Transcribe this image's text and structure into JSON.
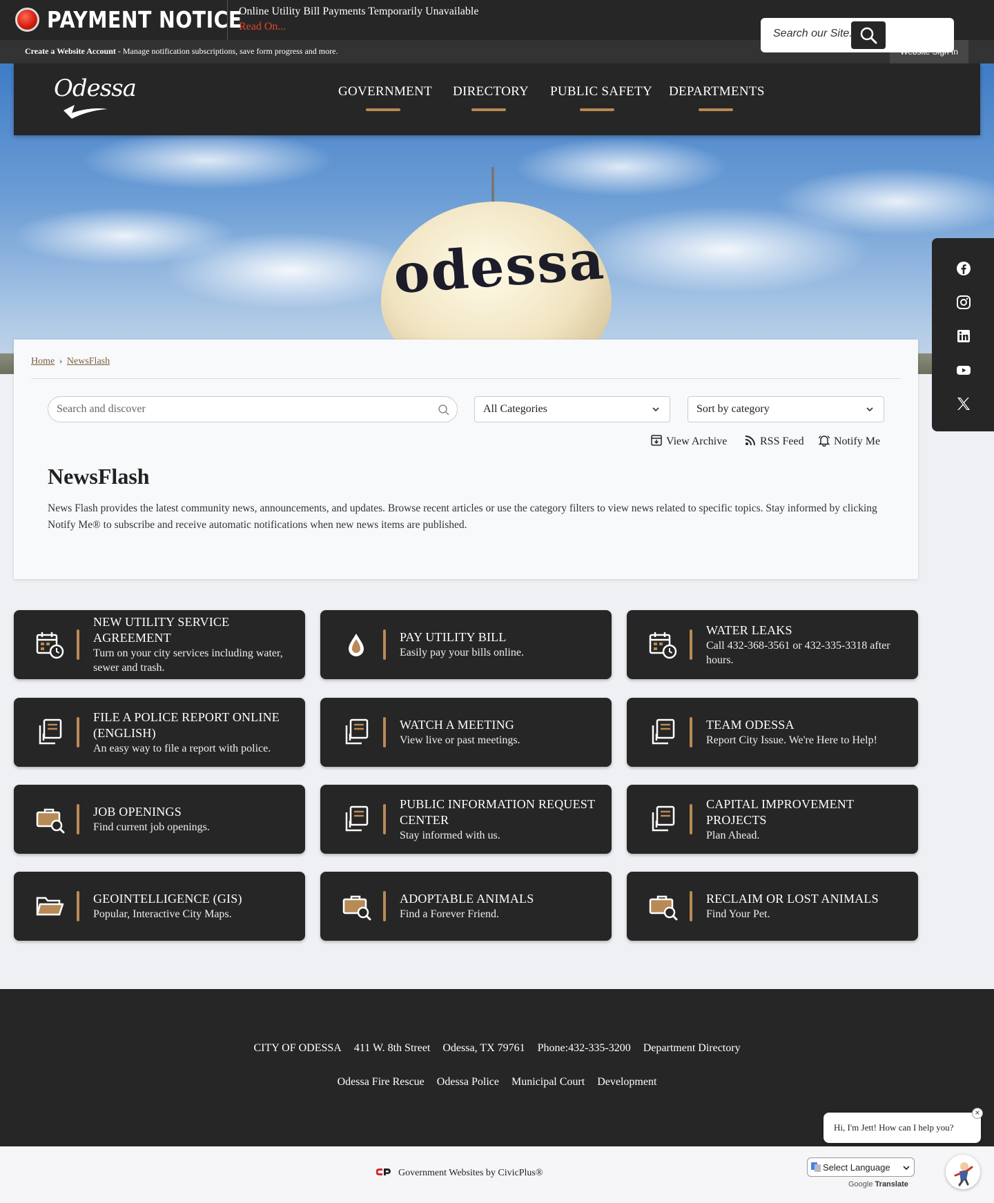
{
  "alert": {
    "title": "PAYMENT NOTICE",
    "message": "Online Utility Bill Payments Temporarily Unavailable",
    "link": "Read On..."
  },
  "account_bar": {
    "create_label": "Create a Website Account",
    "create_desc": " - Manage notification subscriptions, save form progress and more.",
    "signin": "Website Sign In"
  },
  "header": {
    "logo_text": "Odessa",
    "nav": [
      "GOVERNMENT",
      "DIRECTORY",
      "PUBLIC SAFETY",
      "DEPARTMENTS"
    ],
    "search_placeholder": "Search our Site..."
  },
  "hero": {
    "tower_text": "odessa"
  },
  "social": [
    "facebook-icon",
    "instagram-icon",
    "linkedin-icon",
    "youtube-icon",
    "x-icon"
  ],
  "breadcrumb": {
    "home": "Home",
    "sep": "›",
    "current": "NewsFlash"
  },
  "filters": {
    "search_placeholder": "Search and discover",
    "category": "All Categories",
    "sort": "Sort by category"
  },
  "tools": {
    "archive": "View Archive",
    "rss": "RSS Feed",
    "notify": "Notify Me"
  },
  "page": {
    "title": "NewsFlash",
    "description": "News Flash provides the latest community news, announcements, and updates. Browse recent articles or use the category filters to view news related to specific topics. Stay informed by clicking Notify Me® to subscribe and receive automatic notifications when new news items are published."
  },
  "tiles": [
    {
      "title": "NEW UTILITY SERVICE AGREEMENT",
      "sub": "Turn on your city services including water, sewer and trash.",
      "icon": "calendar-clock-icon"
    },
    {
      "title": "PAY UTILITY BILL",
      "sub": "Easily pay your bills online.",
      "icon": "water-drop-icon"
    },
    {
      "title": "WATER LEAKS",
      "sub": "Call 432-368-3561 or 432-335-3318 after hours.",
      "icon": "calendar-clock-icon"
    },
    {
      "title": "FILE A POLICE REPORT ONLINE (ENGLISH)",
      "sub": "An easy way to file a report with police.",
      "icon": "documents-icon"
    },
    {
      "title": "WATCH A MEETING",
      "sub": "View live or past meetings.",
      "icon": "documents-icon"
    },
    {
      "title": "TEAM ODESSA",
      "sub": "Report City Issue. We're Here to Help!",
      "icon": "documents-icon"
    },
    {
      "title": "JOB OPENINGS",
      "sub": "Find current job openings.",
      "icon": "briefcase-search-icon"
    },
    {
      "title": "PUBLIC INFORMATION REQUEST CENTER",
      "sub": "Stay informed with us.",
      "icon": "documents-icon"
    },
    {
      "title": "CAPITAL IMPROVEMENT PROJECTS",
      "sub": "Plan Ahead.",
      "icon": "documents-icon"
    },
    {
      "title": "GEOINTELLIGENCE (GIS)",
      "sub": "Popular, Interactive City Maps.",
      "icon": "folder-icon"
    },
    {
      "title": "ADOPTABLE ANIMALS",
      "sub": "Find a Forever Friend.",
      "icon": "briefcase-search-icon"
    },
    {
      "title": "RECLAIM OR LOST ANIMALS",
      "sub": "Find Your Pet.",
      "icon": "briefcase-search-icon"
    }
  ],
  "footer": {
    "row1": [
      "CITY OF ODESSA",
      "411 W. 8th Street",
      "Odessa, TX 79761",
      "Phone:432-335-3200",
      "Department Directory"
    ],
    "row2": [
      "Odessa Fire Rescue",
      "Odessa Police",
      "Municipal Court",
      "Development"
    ]
  },
  "bottom": {
    "civicplus": "Government Websites by CivicPlus®",
    "language": "Select Language",
    "google": "Google",
    "translate": "Translate"
  },
  "chat": {
    "greeting": "Hi, I'm Jett! How can I help you?",
    "close": "×"
  },
  "colors": {
    "accent": "#b88a55",
    "dark": "#262626",
    "alert_link": "#e3442f"
  }
}
